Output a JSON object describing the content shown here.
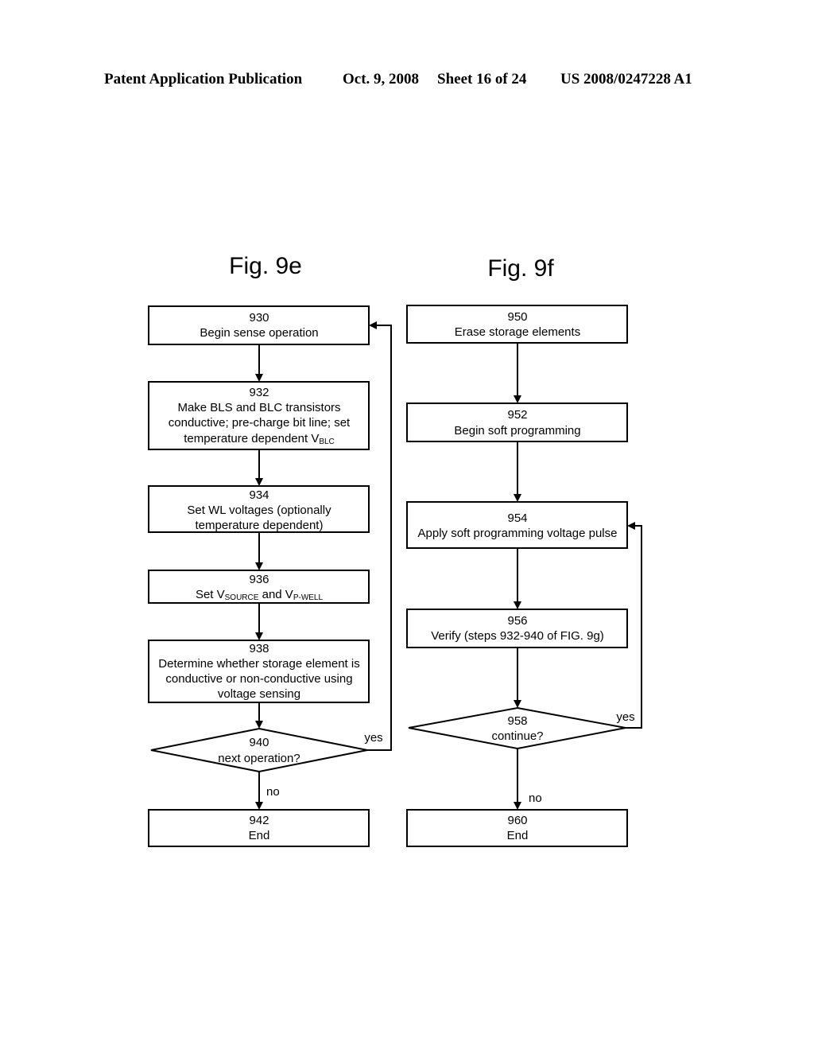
{
  "header": {
    "publication": "Patent Application Publication",
    "date": "Oct. 9, 2008",
    "sheet": "Sheet 16 of 24",
    "number": "US 2008/0247228 A1"
  },
  "fig9e": {
    "title": "Fig. 9e",
    "steps": {
      "s930": {
        "num": "930",
        "text": "Begin sense operation"
      },
      "s932": {
        "num": "932",
        "line1": "Make BLS and BLC transistors",
        "line2": "conductive; pre-charge bit line; set",
        "line3": "temperature dependent V",
        "line3_sub": "BLC"
      },
      "s934": {
        "num": "934",
        "line1": "Set WL voltages (optionally",
        "line2": "temperature dependent)"
      },
      "s936": {
        "num": "936",
        "pre": "Set V",
        "sub1": "SOURCE",
        "mid": " and V",
        "sub2": "P-WELL"
      },
      "s938": {
        "num": "938",
        "line1": "Determine whether storage element is",
        "line2": "conductive or non-conductive using",
        "line3": "voltage sensing"
      },
      "s940": {
        "num": "940",
        "text": "next operation?",
        "yes": "yes",
        "no": "no"
      },
      "s942": {
        "num": "942",
        "text": "End"
      }
    }
  },
  "fig9f": {
    "title": "Fig. 9f",
    "steps": {
      "s950": {
        "num": "950",
        "text": "Erase storage elements"
      },
      "s952": {
        "num": "952",
        "text": "Begin soft programming"
      },
      "s954": {
        "num": "954",
        "text": "Apply soft programming voltage pulse"
      },
      "s956": {
        "num": "956",
        "text": "Verify (steps 932-940 of FIG. 9g)"
      },
      "s958": {
        "num": "958",
        "text": "continue?",
        "yes": "yes",
        "no": "no"
      },
      "s960": {
        "num": "960",
        "text": "End"
      }
    }
  }
}
